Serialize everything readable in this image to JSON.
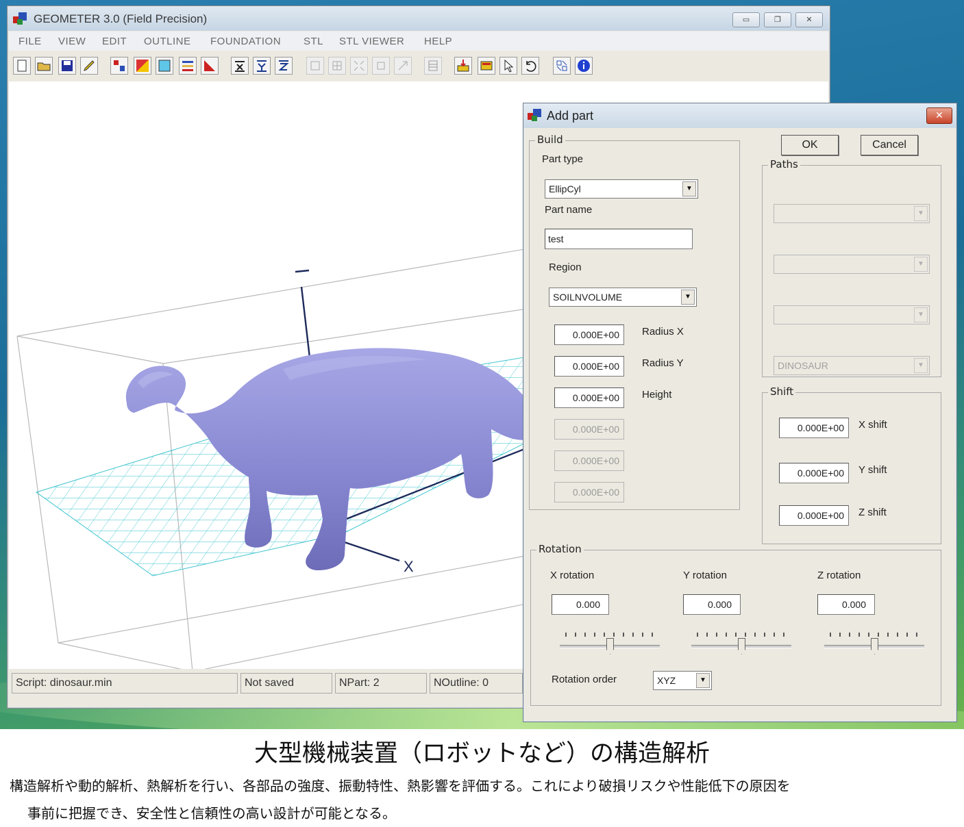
{
  "main_window": {
    "title": "GEOMETER 3.0 (Field Precision)",
    "window_buttons": [
      "▭",
      "❐",
      "✕"
    ],
    "menu": [
      "FILE",
      "VIEW",
      "EDIT",
      "OUTLINE",
      "FOUNDATION",
      "STL",
      "STL VIEWER",
      "HELP"
    ],
    "viewport": {
      "axis_label_x": "X"
    },
    "status": {
      "script": "Script: dinosaur.min",
      "saved": "Not saved",
      "npart": "NPart:    2",
      "noutline": "NOutline:   0"
    }
  },
  "dialog": {
    "title": "Add part",
    "close_glyph": "✕",
    "ok_label": "OK",
    "cancel_label": "Cancel",
    "build": {
      "legend": "Build",
      "part_type_label": "Part type",
      "part_type_value": "EllipCyl",
      "part_name_label": "Part name",
      "part_name_value": "test",
      "region_label": "Region",
      "region_value": "SOILNVOLUME",
      "fields": [
        {
          "value": "0.000E+00",
          "label": "Radius X"
        },
        {
          "value": "0.000E+00",
          "label": "Radius Y"
        },
        {
          "value": "0.000E+00",
          "label": "Height"
        },
        {
          "value": "0.000E+00",
          "label": ""
        },
        {
          "value": "0.000E+00",
          "label": ""
        },
        {
          "value": "0.000E+00",
          "label": ""
        }
      ]
    },
    "paths": {
      "legend": "Paths",
      "combos": [
        "",
        "",
        "",
        "DINOSAUR"
      ]
    },
    "shift": {
      "legend": "Shift",
      "x": {
        "value": "0.000E+00",
        "label": "X shift"
      },
      "y": {
        "value": "0.000E+00",
        "label": "Y shift"
      },
      "z": {
        "value": "0.000E+00",
        "label": "Z shift"
      }
    },
    "rotation": {
      "legend": "Rotation",
      "x": {
        "label": "X rotation",
        "value": "0.000"
      },
      "y": {
        "label": "Y rotation",
        "value": "0.000"
      },
      "z": {
        "label": "Z rotation",
        "value": "0.000"
      },
      "order_label": "Rotation order",
      "order_value": "XYZ"
    }
  },
  "caption": {
    "title": "大型機械装置（ロボットなど）の構造解析",
    "line1": "構造解析や動的解析、熱解析を行い、各部品の強度、振動特性、熱影響を評価する。これにより破損リスクや性能低下の原因を",
    "line2": "事前に把握でき、安全性と信頼性の高い設計が可能となる。"
  },
  "icons": [
    "new-file-icon",
    "open-folder-icon",
    "save-disk-icon",
    "pencil-icon",
    "region-icon",
    "color-palette-icon",
    "rectangle-icon",
    "list-icon",
    "corner-icon",
    "axis-x-icon",
    "axis-y-icon",
    "axis-z-icon",
    "zoom-icon",
    "grid-icon",
    "expand-icon",
    "fit-icon",
    "arrow-icon",
    "table-icon",
    "import-icon",
    "export-icon",
    "pointer-icon",
    "undo-icon",
    "scale-icon",
    "info-icon"
  ]
}
